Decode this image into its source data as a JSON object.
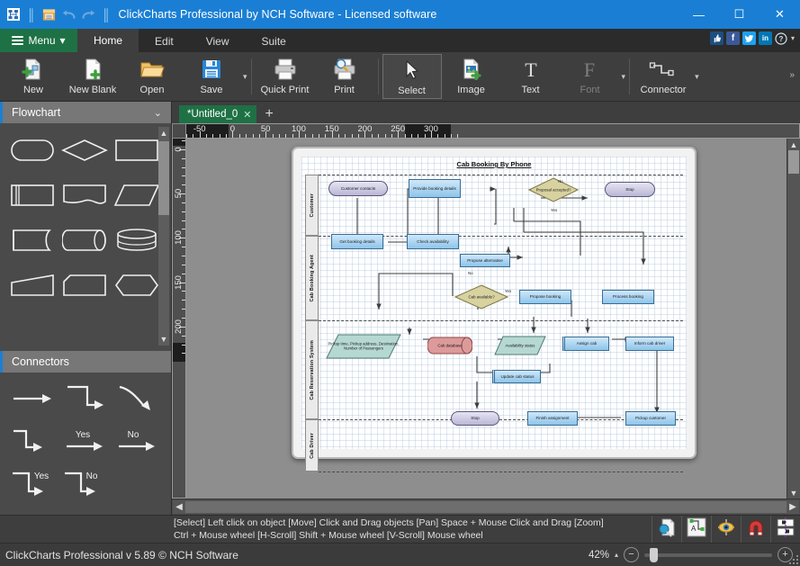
{
  "titlebar": {
    "title": "ClickCharts Professional by NCH Software - Licensed software",
    "icons": [
      "app-icon",
      "save-icon",
      "undo-icon",
      "redo-icon"
    ],
    "minimize": "—",
    "maximize": "☐",
    "close": "✕"
  },
  "menubar": {
    "menu_label": "Menu",
    "menu_caret": "▾",
    "tabs": [
      {
        "label": "Home",
        "active": true
      },
      {
        "label": "Edit",
        "active": false
      },
      {
        "label": "View",
        "active": false
      },
      {
        "label": "Suite",
        "active": false
      }
    ],
    "social": [
      "thumbs-up-icon",
      "facebook-icon",
      "twitter-icon",
      "linkedin-icon",
      "help-icon"
    ],
    "social_labels": {
      "facebook": "f",
      "twitter": "t",
      "linkedin": "in",
      "help": "?"
    },
    "social_caret": "▾"
  },
  "ribbon": {
    "buttons": [
      {
        "label": "New",
        "icon": "new-document-icon",
        "state": "normal",
        "dropdown": false
      },
      {
        "label": "New Blank",
        "icon": "new-blank-document-icon",
        "state": "normal",
        "dropdown": false
      },
      {
        "label": "Open",
        "icon": "open-folder-icon",
        "state": "normal",
        "dropdown": false
      },
      {
        "label": "Save",
        "icon": "save-floppy-icon",
        "state": "normal",
        "dropdown": true
      },
      {
        "label": "Quick Print",
        "icon": "printer-icon",
        "state": "normal",
        "dropdown": false
      },
      {
        "label": "Print",
        "icon": "print-preview-icon",
        "state": "normal",
        "dropdown": false
      },
      {
        "label": "Select",
        "icon": "cursor-arrow-icon",
        "state": "selected",
        "dropdown": false
      },
      {
        "label": "Image",
        "icon": "image-icon",
        "state": "normal",
        "dropdown": false
      },
      {
        "label": "Text",
        "icon": "text-icon",
        "state": "normal",
        "dropdown": false
      },
      {
        "label": "Font",
        "icon": "font-icon",
        "state": "disabled",
        "dropdown": true
      },
      {
        "label": "Connector",
        "icon": "connector-icon",
        "state": "normal",
        "dropdown": true
      }
    ],
    "overflow": "»",
    "dropdown_caret": "▾"
  },
  "left_panel": {
    "shapes_header": "Flowchart",
    "shapes_caret": "⌄",
    "connectors_header": "Connectors",
    "shapes": [
      "rounded-rectangle-shape",
      "diamond-shape",
      "rectangle-shape",
      "predefined-process-shape",
      "document-shape",
      "parallelogram-shape",
      "delay-shape",
      "cylinder-horizontal-shape",
      "database-shape",
      "trapezoid-shape",
      "hexagon-cut-shape",
      "hexagon-shape"
    ],
    "connectors": [
      {
        "icon": "straight-arrow-connector",
        "label": ""
      },
      {
        "icon": "step-down-right-connector",
        "label": ""
      },
      {
        "icon": "curve-connector",
        "label": ""
      },
      {
        "icon": "step-right-down-connector",
        "label": ""
      },
      {
        "icon": "straight-arrow-connector",
        "label": "Yes"
      },
      {
        "icon": "straight-arrow-connector",
        "label": "No"
      },
      {
        "icon": "step-connector",
        "label": "Yes"
      },
      {
        "icon": "step-connector",
        "label": "No"
      }
    ]
  },
  "doctab": {
    "name": "*Untitled_0",
    "close": "✕",
    "new_tab": "+"
  },
  "rulers": {
    "horizontal_ticks": [
      -50,
      0,
      50,
      100,
      150,
      200,
      250,
      300
    ],
    "vertical_ticks": [
      0,
      50,
      100,
      150,
      200
    ]
  },
  "chart_data": {
    "type": "diagram",
    "title": "Cab Booking By Phone",
    "lanes": [
      "Customer",
      "Cab Booking Agent",
      "Cab Reservation System",
      "Cab Driver"
    ],
    "nodes": [
      {
        "id": "n1",
        "label": "Customer contacts",
        "shape": "terminator",
        "lane": "Customer"
      },
      {
        "id": "n2",
        "label": "Provide booking details",
        "shape": "process",
        "lane": "Customer"
      },
      {
        "id": "n3",
        "label": "Proposal accepted?",
        "shape": "decision",
        "lane": "Customer"
      },
      {
        "id": "n4",
        "label": "Stop",
        "shape": "terminator",
        "lane": "Customer"
      },
      {
        "id": "n5",
        "label": "Get booking details",
        "shape": "process",
        "lane": "Cab Booking Agent"
      },
      {
        "id": "n6",
        "label": "Check availability",
        "shape": "process",
        "lane": "Cab Booking Agent"
      },
      {
        "id": "n7",
        "label": "Propose alternative",
        "shape": "process",
        "lane": "Cab Booking Agent"
      },
      {
        "id": "n8",
        "label": "Cab available?",
        "shape": "decision",
        "lane": "Cab Booking Agent"
      },
      {
        "id": "n9",
        "label": "Propose booking",
        "shape": "process",
        "lane": "Cab Booking Agent"
      },
      {
        "id": "n10",
        "label": "Process booking",
        "shape": "process",
        "lane": "Cab Booking Agent"
      },
      {
        "id": "n11",
        "label": "Pickup time, Pickup address, Destination, Number of Passengers",
        "shape": "data",
        "lane": "Cab Reservation System"
      },
      {
        "id": "n12",
        "label": "Cab database",
        "shape": "database",
        "lane": "Cab Reservation System"
      },
      {
        "id": "n13",
        "label": "Availability status",
        "shape": "data",
        "lane": "Cab Reservation System"
      },
      {
        "id": "n14",
        "label": "Assign cab",
        "shape": "predefined",
        "lane": "Cab Reservation System"
      },
      {
        "id": "n15",
        "label": "Inform cab driver",
        "shape": "process",
        "lane": "Cab Reservation System"
      },
      {
        "id": "n16",
        "label": "Update cab status",
        "shape": "predefined",
        "lane": "Cab Reservation System"
      },
      {
        "id": "n17",
        "label": "Stop",
        "shape": "terminator",
        "lane": "Cab Driver"
      },
      {
        "id": "n18",
        "label": "Finish assignment",
        "shape": "process",
        "lane": "Cab Driver"
      },
      {
        "id": "n19",
        "label": "Pickup customer",
        "shape": "process",
        "lane": "Cab Driver"
      }
    ],
    "edge_labels": [
      "No",
      "Yes",
      "No",
      "Yes"
    ],
    "colors": {
      "process": "#8ec5ea",
      "decision": "#cdc68a",
      "terminator": "#b9b6d6",
      "database": "#d79a9a",
      "data": "#a9cfc9"
    }
  },
  "statusbar": {
    "hint_line1": "[Select] Left click on object  [Move] Click and Drag objects  [Pan] Space + Mouse Click and Drag  [Zoom]",
    "hint_line2": "Ctrl + Mouse wheel  [H-Scroll] Shift + Mouse wheel  [V-Scroll] Mouse wheel",
    "tools": [
      "zoom-tool-icon",
      "connector-label-tool-icon",
      "visibility-eye-icon",
      "magnet-snap-icon",
      "align-distribute-icon"
    ]
  },
  "zoombar": {
    "version": "ClickCharts Professional v 5.89 © NCH Software",
    "zoom_value": "42%",
    "zoom_caret": "▴",
    "minus": "−",
    "plus": "+"
  }
}
